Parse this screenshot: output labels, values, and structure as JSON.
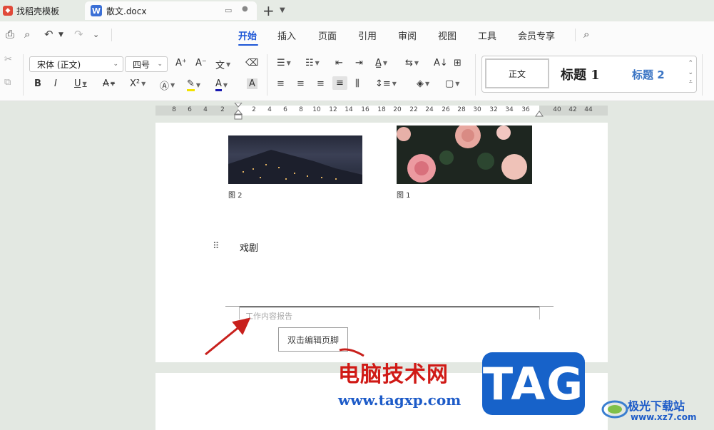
{
  "tabs": [
    {
      "label": "找稻壳模板",
      "icon": "docer-icon"
    },
    {
      "label": "散文.docx",
      "icon": "word-doc-icon"
    }
  ],
  "menu": {
    "items": [
      "开始",
      "插入",
      "页面",
      "引用",
      "审阅",
      "视图",
      "工具",
      "会员专享"
    ],
    "active": "开始"
  },
  "ribbon": {
    "font_name": "宋体 (正文)",
    "font_size": "四号",
    "style_normal": "正文",
    "style_h1": "标题 1",
    "style_h2": "标题 2"
  },
  "ruler": {
    "ticks": [
      "8",
      "6",
      "4",
      "2",
      "2",
      "4",
      "6",
      "8",
      "10",
      "12",
      "14",
      "16",
      "18",
      "20",
      "22",
      "24",
      "26",
      "28",
      "30",
      "32",
      "34",
      "36",
      "40",
      "42",
      "44"
    ]
  },
  "document": {
    "caption_left": "图 2",
    "caption_right": "图 1",
    "paragraph": "戏剧",
    "footer_text": "工作内容报告",
    "footer_tip": "双击编辑页脚"
  },
  "watermark": {
    "text": "电脑技术网",
    "url": "www.tagxp.com",
    "tag": "TAG",
    "site_name": "极光下载站",
    "site_url": "www.xz7.com"
  },
  "colors": {
    "accent": "#1d56d6",
    "arrow": "#c8201c",
    "tag_bg": "#1762c9"
  }
}
